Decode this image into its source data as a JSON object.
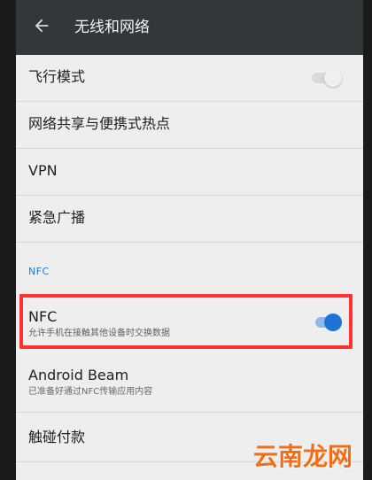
{
  "header": {
    "title": "无线和网络"
  },
  "settings": {
    "airplane_mode": "飞行模式",
    "hotspot": "网络共享与便携式热点",
    "vpn": "VPN",
    "emergency_broadcast": "紧急广播"
  },
  "nfc_section": {
    "header": "NFC",
    "nfc_title": "NFC",
    "nfc_description": "允许手机在接触其他设备时交换数据",
    "android_beam_title": "Android Beam",
    "android_beam_description": "已准备好通过NFC传输应用内容",
    "tap_pay": "触碰付款"
  },
  "watermark": {
    "text": "云南龙网"
  },
  "icons": {
    "back": "arrow-left",
    "toggles": [
      "toggle-off",
      "toggle-on"
    ]
  },
  "colors": {
    "accent": "#1f73d3",
    "highlight": "#ff3131",
    "watermark": "#f16d16"
  }
}
